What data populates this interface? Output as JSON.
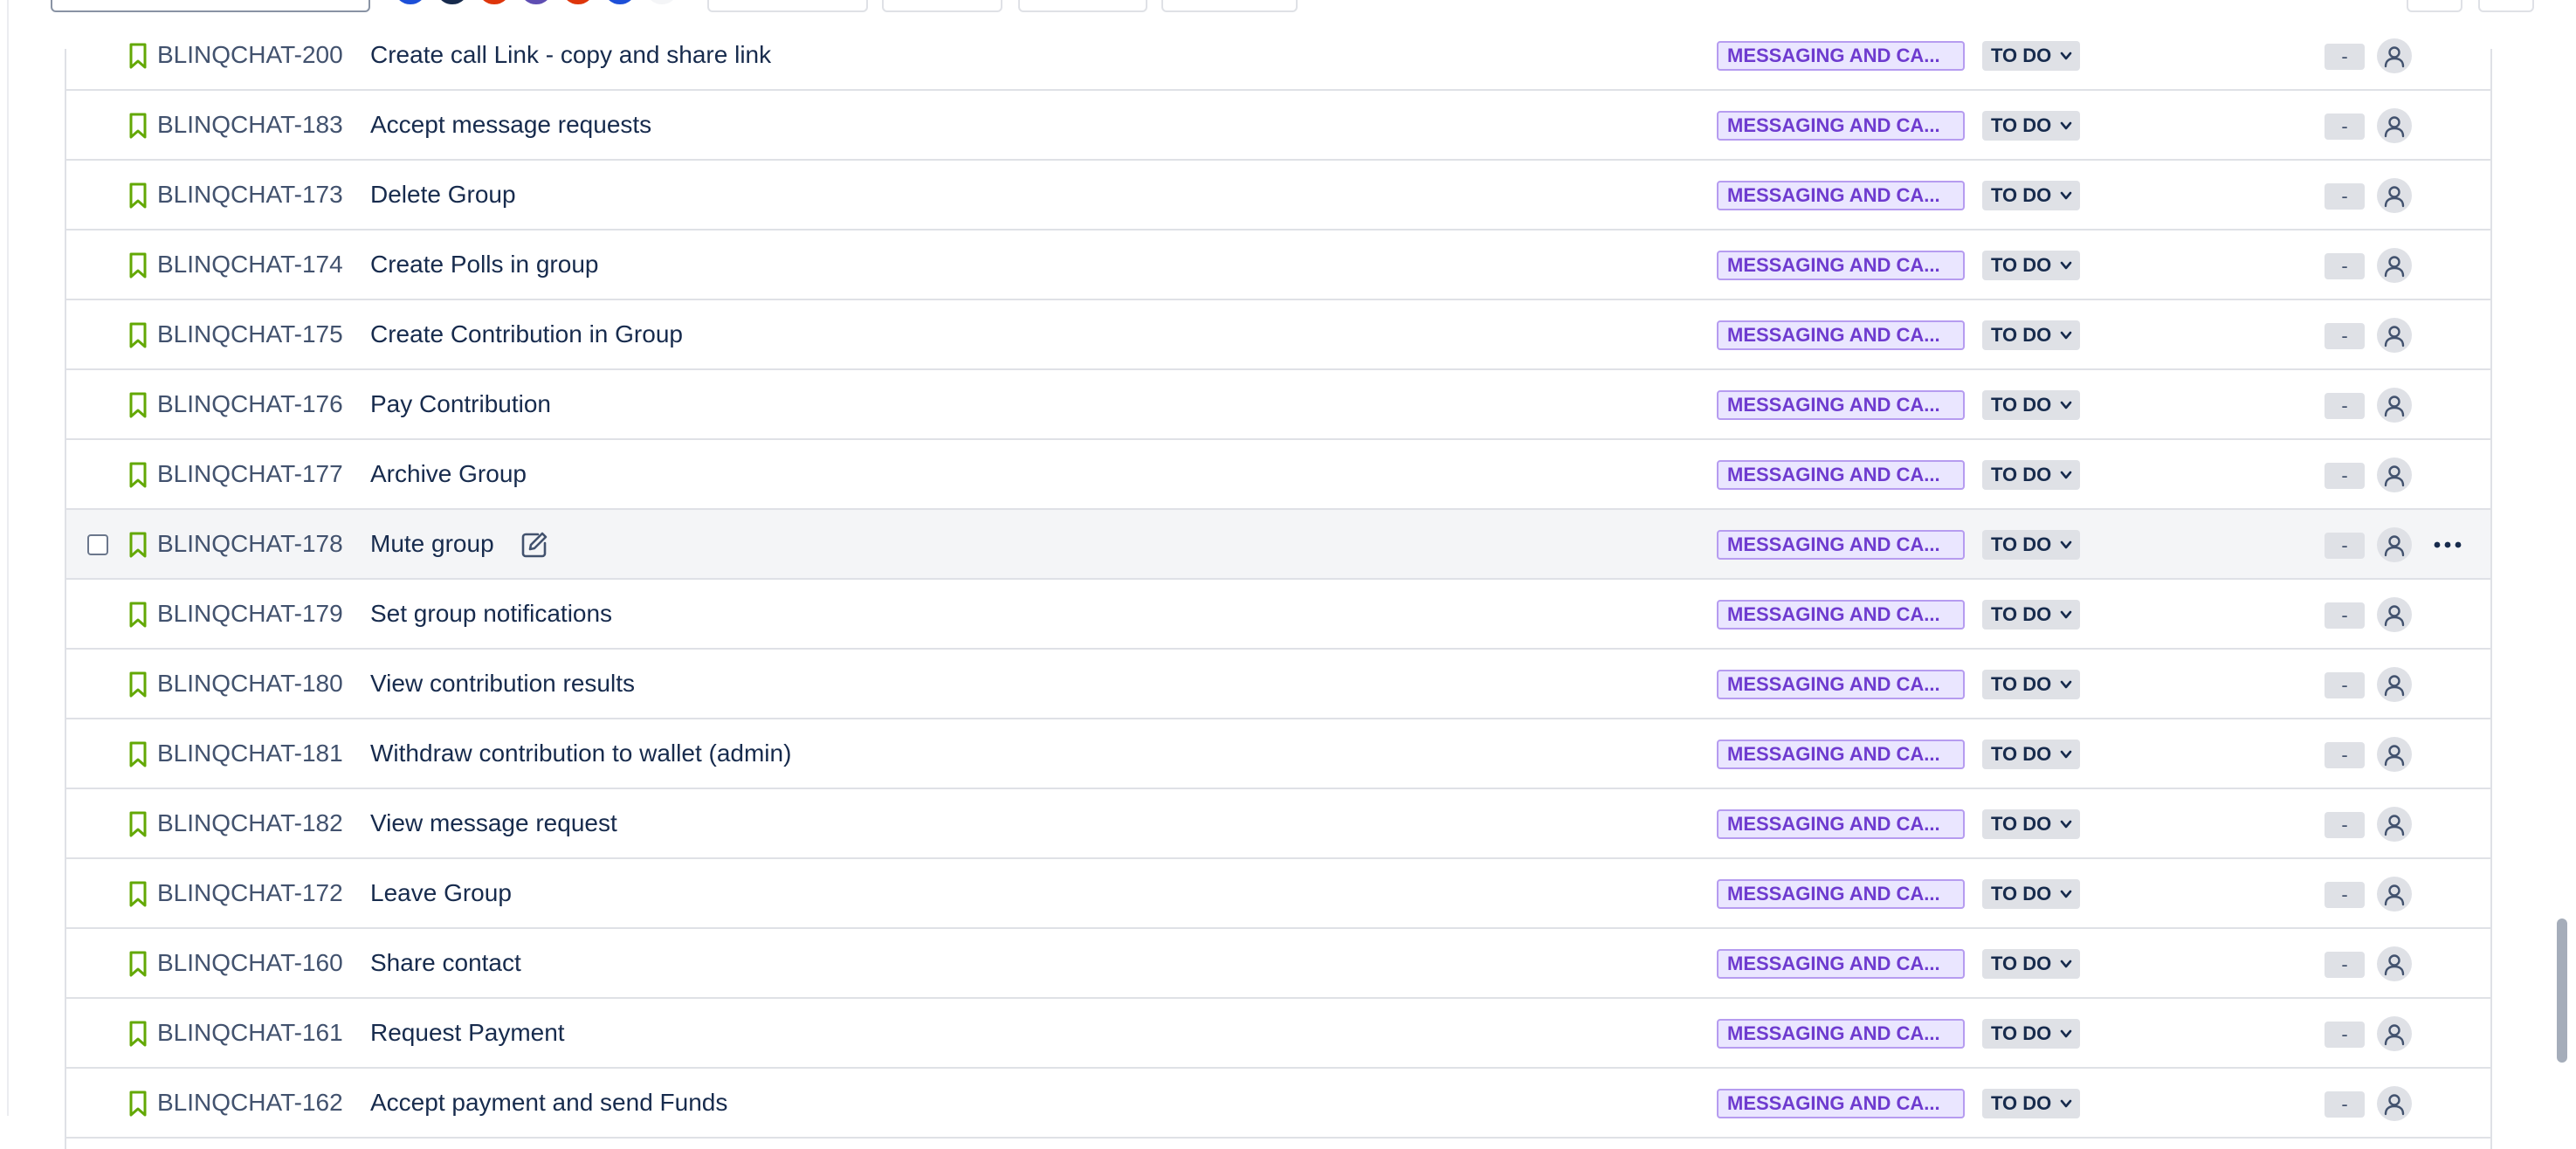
{
  "colors": {
    "epic_bg": "#eae6ff",
    "epic_text": "#6e3bcf",
    "story_icon": "#63a805",
    "status_bg": "#dfe1e6",
    "row_border": "#dfe1e6",
    "hover_bg": "#f4f5f7"
  },
  "icons": {
    "issue_type": "bookmark-icon",
    "edit": "edit-icon",
    "status_dropdown": "chevron-down-icon",
    "assignee": "avatar-icon",
    "more": "more-icon"
  },
  "issues": [
    {
      "key": "BLINQCHAT-200",
      "summary": "Create call Link - copy and share link",
      "epic": "MESSAGING AND CA...",
      "status": "TO DO",
      "estimate": "-"
    },
    {
      "key": "BLINQCHAT-183",
      "summary": "Accept message requests",
      "epic": "MESSAGING AND CA...",
      "status": "TO DO",
      "estimate": "-"
    },
    {
      "key": "BLINQCHAT-173",
      "summary": "Delete Group",
      "epic": "MESSAGING AND CA...",
      "status": "TO DO",
      "estimate": "-"
    },
    {
      "key": "BLINQCHAT-174",
      "summary": "Create Polls in group",
      "epic": "MESSAGING AND CA...",
      "status": "TO DO",
      "estimate": "-"
    },
    {
      "key": "BLINQCHAT-175",
      "summary": "Create Contribution in Group",
      "epic": "MESSAGING AND CA...",
      "status": "TO DO",
      "estimate": "-"
    },
    {
      "key": "BLINQCHAT-176",
      "summary": "Pay Contribution",
      "epic": "MESSAGING AND CA...",
      "status": "TO DO",
      "estimate": "-"
    },
    {
      "key": "BLINQCHAT-177",
      "summary": "Archive Group",
      "epic": "MESSAGING AND CA...",
      "status": "TO DO",
      "estimate": "-"
    },
    {
      "key": "BLINQCHAT-178",
      "summary": "Mute group",
      "epic": "MESSAGING AND CA...",
      "status": "TO DO",
      "estimate": "-"
    },
    {
      "key": "BLINQCHAT-179",
      "summary": "Set group notifications",
      "epic": "MESSAGING AND CA...",
      "status": "TO DO",
      "estimate": "-"
    },
    {
      "key": "BLINQCHAT-180",
      "summary": "View contribution results",
      "epic": "MESSAGING AND CA...",
      "status": "TO DO",
      "estimate": "-"
    },
    {
      "key": "BLINQCHAT-181",
      "summary": "Withdraw contribution to wallet (admin)",
      "epic": "MESSAGING AND CA...",
      "status": "TO DO",
      "estimate": "-"
    },
    {
      "key": "BLINQCHAT-182",
      "summary": "View message request",
      "epic": "MESSAGING AND CA...",
      "status": "TO DO",
      "estimate": "-"
    },
    {
      "key": "BLINQCHAT-172",
      "summary": "Leave Group",
      "epic": "MESSAGING AND CA...",
      "status": "TO DO",
      "estimate": "-"
    },
    {
      "key": "BLINQCHAT-160",
      "summary": "Share contact",
      "epic": "MESSAGING AND CA...",
      "status": "TO DO",
      "estimate": "-"
    },
    {
      "key": "BLINQCHAT-161",
      "summary": "Request Payment",
      "epic": "MESSAGING AND CA...",
      "status": "TO DO",
      "estimate": "-"
    },
    {
      "key": "BLINQCHAT-162",
      "summary": "Accept payment and send Funds",
      "epic": "MESSAGING AND CA...",
      "status": "TO DO",
      "estimate": "-"
    }
  ]
}
